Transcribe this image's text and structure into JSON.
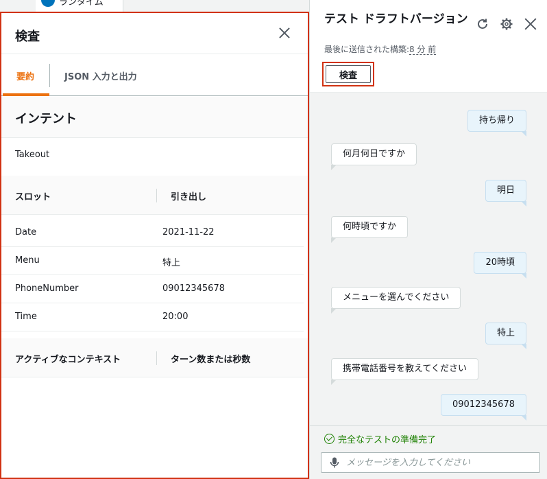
{
  "top_tab": {
    "label": "ランタイム"
  },
  "inspect_panel": {
    "title": "検査",
    "tabs": [
      {
        "label": "要約"
      },
      {
        "label": "JSON 入力と出力"
      }
    ],
    "intent_heading": "インテント",
    "intent_value": "Takeout",
    "slots_headers": {
      "slot": "スロット",
      "elicit": "引き出し"
    },
    "slots": [
      {
        "name": "Date",
        "value": "2021-11-22"
      },
      {
        "name": "Menu",
        "value": "特上"
      },
      {
        "name": "PhoneNumber",
        "value": "09012345678"
      },
      {
        "name": "Time",
        "value": "20:00"
      }
    ],
    "context_headers": {
      "context": "アクティブなコンテキスト",
      "turns": "ターン数または秒数"
    }
  },
  "test_panel": {
    "title": "テスト ドラフトバージョン",
    "subtitle_prefix": "最後に送信された構築:",
    "subtitle_time": "8 分 前",
    "inspect_button": "検査",
    "messages": [
      {
        "from": "user",
        "text": "持ち帰り"
      },
      {
        "from": "bot",
        "text": "何月何日ですか"
      },
      {
        "from": "user",
        "text": "明日"
      },
      {
        "from": "bot",
        "text": "何時頃ですか"
      },
      {
        "from": "user",
        "text": "20時頃"
      },
      {
        "from": "bot",
        "text": "メニューを選んでください"
      },
      {
        "from": "user",
        "text": "特上"
      },
      {
        "from": "bot",
        "text": "携帯電話番号を教えてください"
      },
      {
        "from": "user",
        "text": "09012345678"
      }
    ],
    "status": "完全なテストの準備完了",
    "input_placeholder": "メッセージを入力してください"
  },
  "colors": {
    "accent": "#ec7211",
    "highlight": "#d13212",
    "success": "#1d8102",
    "user_bubble": "#e8f4fb"
  },
  "icons": [
    "close-icon",
    "refresh-icon",
    "gear-icon",
    "check-circle-icon",
    "microphone-icon"
  ]
}
